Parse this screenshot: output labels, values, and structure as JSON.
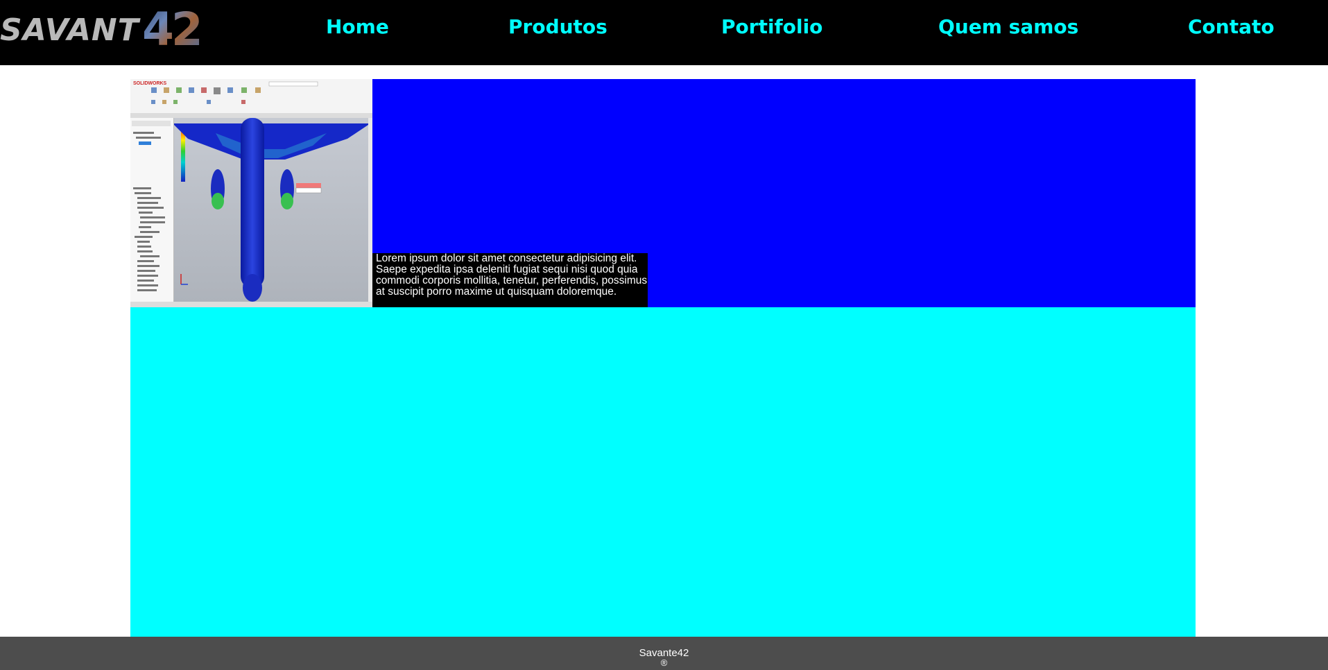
{
  "header": {
    "logo": {
      "text": "SAVANT",
      "number": "42"
    },
    "nav": [
      {
        "label": "Home"
      },
      {
        "label": "Produtos"
      },
      {
        "label": "Portifolio"
      },
      {
        "label": "Quem samos"
      },
      {
        "label": "Contato"
      }
    ]
  },
  "feature": {
    "caption": "Lorem ipsum dolor sit amet consectetur adipisicing elit. Saepe expedita ipsa deleniti fugiat sequi nisi quod quia commodi corporis mollitia, tenetur, perferendis, possimus at suscipit porro maxime ut quisquam doloremque.",
    "image": {
      "brand": "SOLIDWORKS"
    }
  },
  "footer": {
    "name": "Savante42",
    "mark": "®"
  },
  "colors": {
    "header_bg": "#000000",
    "nav_link": "#00ffff",
    "feature_bg": "#0000ff",
    "content_bg": "#00ffff",
    "footer_bg": "#4d4d4d"
  }
}
